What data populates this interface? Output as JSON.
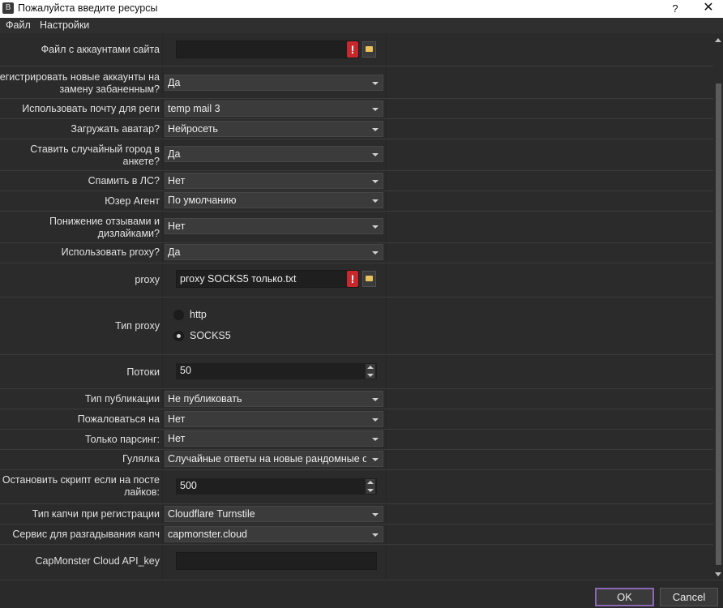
{
  "window": {
    "title": "Пожалуйста введите ресурсы",
    "icon": "app-icon",
    "icon_glyph": "B",
    "help": "?",
    "close": "✕"
  },
  "menu": {
    "items": [
      "Файл",
      "Настройки"
    ]
  },
  "form": {
    "account_file": {
      "label": "Файл с аккаунтами сайта",
      "value": ""
    },
    "register_new": {
      "label1": "Регистрировать новые аккаунты на",
      "label2": "замену забаненным?",
      "value": "Да"
    },
    "mail": {
      "label": "Использовать почту для реги",
      "value": "temp mail 3"
    },
    "avatar": {
      "label": "Загружать аватар?",
      "value": "Нейросеть"
    },
    "random_city": {
      "label1": "Ставить случайный город в",
      "label2": "анкете?",
      "value": "Да"
    },
    "spam_pm": {
      "label": "Спамить в ЛС?",
      "value": "Нет"
    },
    "user_agent": {
      "label": "Юзер Агент",
      "value": "По умолчанию"
    },
    "downvote": {
      "label1": "Понижение отзывами и",
      "label2": "дизлайками?",
      "value": "Нет"
    },
    "use_proxy": {
      "label": "Использовать proxy?",
      "value": "Да"
    },
    "proxy_file": {
      "label": "proxy",
      "value": "proxy SOCKS5 только.txt"
    },
    "proxy_type": {
      "label": "Тип proxy",
      "options": [
        "http",
        "SOCKS5"
      ],
      "selected": "SOCKS5"
    },
    "threads": {
      "label": "Потоки",
      "value": "50"
    },
    "publish_type": {
      "label": "Тип публикации",
      "value": "Не публиковать"
    },
    "complain": {
      "label": "Пожаловаться на",
      "value": "Нет"
    },
    "parse_only": {
      "label": "Только парсинг:",
      "value": "Нет"
    },
    "walk": {
      "label": "Гулялка",
      "value": "Случайные ответы на новые рандомные опрс"
    },
    "stop_likes": {
      "label1": "Остановить скрипт если на посте",
      "label2": "лайков:",
      "value": "500"
    },
    "captcha_type": {
      "label": "Тип капчи при регистрации",
      "value": "Cloudflare Turnstile"
    },
    "captcha_service": {
      "label": "Сервис для разгадывания капч",
      "value": "capmonster.cloud"
    },
    "api_key": {
      "label": "CapMonster Cloud API_key",
      "value": ""
    }
  },
  "icons": {
    "warning": "!",
    "folder": "folder-icon"
  },
  "footer": {
    "ok": "OK",
    "cancel": "Cancel"
  },
  "colors": {
    "background": "#2b2b2b",
    "warning": "#c8282c",
    "ok_border": "#8c67b5"
  }
}
